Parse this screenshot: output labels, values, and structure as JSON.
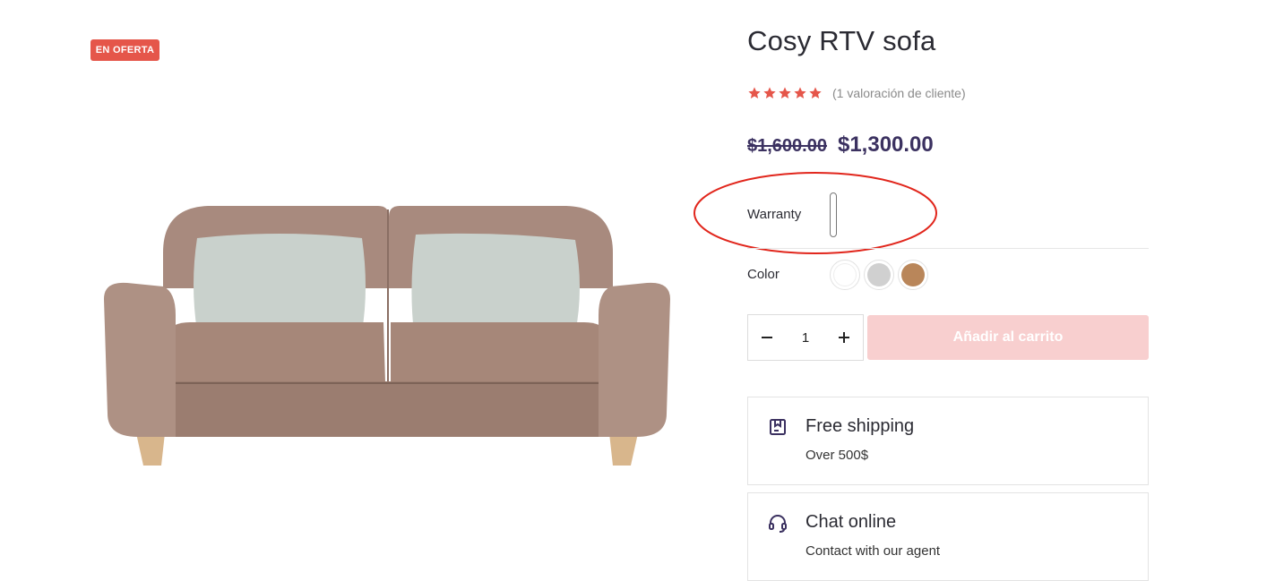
{
  "badge": {
    "sale": "EN OFERTA"
  },
  "product": {
    "title": "Cosy RTV sofa",
    "rating": 5,
    "rating_max": 5,
    "review_text": "(1 valoración de cliente)",
    "old_price": "$1,600.00",
    "new_price": "$1,300.00"
  },
  "options": {
    "warranty_label": "Warranty",
    "warranty_value": "",
    "color_label": "Color",
    "colors": [
      "#ffffff",
      "#d0d0d0",
      "#b9865a"
    ]
  },
  "cart": {
    "quantity": "1",
    "minus_label": "−",
    "plus_label": "+",
    "add_to_cart_label": "Añadir al carrito"
  },
  "features": [
    {
      "title": "Free shipping",
      "subtitle": "Over 500$",
      "icon": "shipping-box-icon"
    },
    {
      "title": "Chat online",
      "subtitle": "Contact with our agent",
      "icon": "headset-icon"
    }
  ],
  "colors": {
    "badge": "#e5564a",
    "star": "#e5564a",
    "price": "#3b3160",
    "button_disabled": "#f8cfcf",
    "annotation": "#e1261c"
  }
}
